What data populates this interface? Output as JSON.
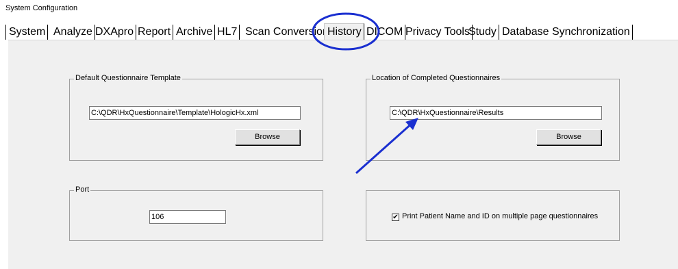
{
  "window": {
    "title": "System Configuration"
  },
  "tabs": [
    {
      "label": "System"
    },
    {
      "label": "Analyze"
    },
    {
      "label": "DXApro"
    },
    {
      "label": "Report"
    },
    {
      "label": "Archive"
    },
    {
      "label": "HL7"
    },
    {
      "label": "Scan Conversion"
    },
    {
      "label": "History",
      "active": true
    },
    {
      "label": "DICOM"
    },
    {
      "label": "Privacy Tools"
    },
    {
      "label": "Study"
    },
    {
      "label": "Database Synchronization"
    }
  ],
  "template_group": {
    "legend": "Default Questionnaire Template",
    "path_value": "C:\\QDR\\HxQuestionnaire\\Template\\HologicHx.xml",
    "browse_label": "Browse"
  },
  "location_group": {
    "legend": "Location of Completed Questionnaires",
    "path_value": "C:\\QDR\\HxQuestionnaire\\Results",
    "browse_label": "Browse"
  },
  "port_group": {
    "legend": "Port",
    "port_value": "106"
  },
  "print_group": {
    "checkbox_checked": true,
    "checkbox_label": "Print Patient Name and ID on multiple page questionnaires"
  },
  "annotation": {
    "color": "#1a2fd0"
  }
}
